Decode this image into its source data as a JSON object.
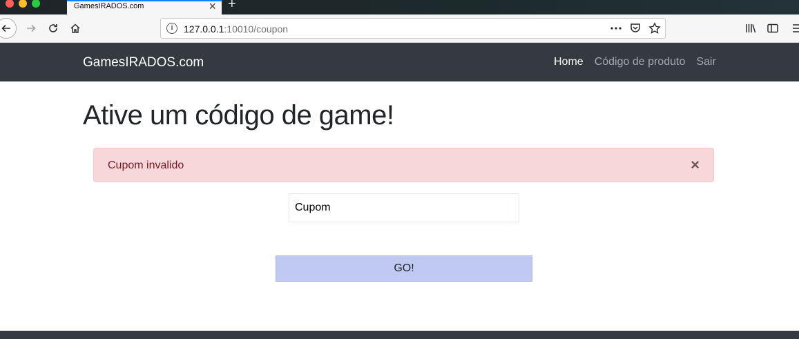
{
  "browser": {
    "tab_title": "GamesIRADOS.com",
    "tab_close": "×",
    "new_tab": "+",
    "url_host": "127.0.0.1",
    "url_rest": ":10010/coupon",
    "info_icon": "i"
  },
  "navbar": {
    "brand": "GamesIRADOS.com",
    "links": [
      {
        "label": "Home",
        "active": true
      },
      {
        "label": "Código de produto",
        "active": false
      },
      {
        "label": "Sair",
        "active": false
      }
    ]
  },
  "main": {
    "title": "Ative um código de game!",
    "alert": {
      "message": "Cupom invalido",
      "close": "×"
    },
    "coupon_input": {
      "value": "Cupom"
    },
    "submit_label": "GO!"
  },
  "colors": {
    "navbar_bg": "#343a40",
    "alert_bg": "#f8d7da",
    "alert_text": "#721c24",
    "button_bg": "#bfc9f1"
  }
}
